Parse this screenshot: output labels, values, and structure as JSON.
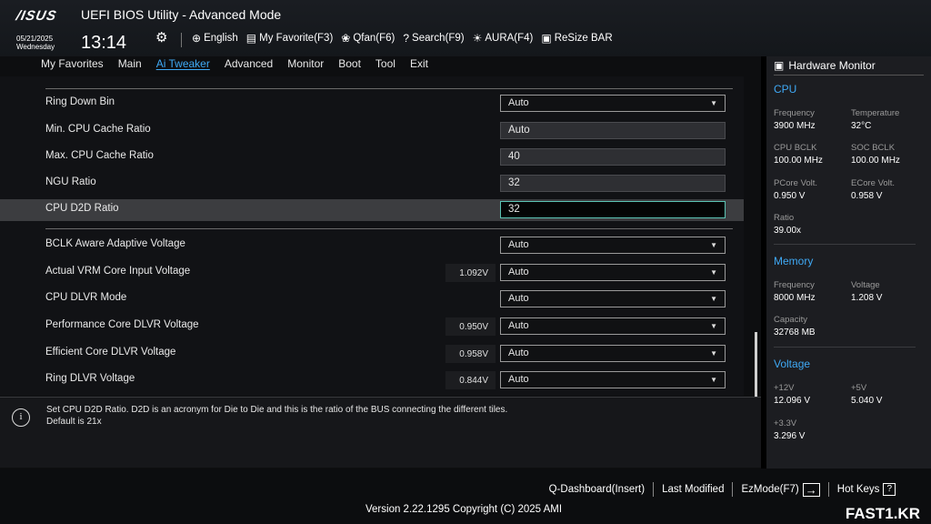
{
  "header": {
    "logo": "/ISUS",
    "title": "UEFI BIOS Utility - Advanced Mode",
    "date": "05/21/2025",
    "weekday": "Wednesday",
    "time": "13:14",
    "toolbar": [
      {
        "icon": "globe-icon",
        "glyph": "⊕",
        "label": "English"
      },
      {
        "icon": "favorite-icon",
        "glyph": "▤",
        "label": "My Favorite(F3)"
      },
      {
        "icon": "fan-icon",
        "glyph": "❀",
        "label": "Qfan(F6)"
      },
      {
        "icon": "search-icon",
        "glyph": "?",
        "label": "Search(F9)"
      },
      {
        "icon": "aura-icon",
        "glyph": "☀",
        "label": "AURA(F4)"
      },
      {
        "icon": "resize-bar-icon",
        "glyph": "▣",
        "label": "ReSize BAR"
      }
    ]
  },
  "tabs": [
    {
      "label": "My Favorites",
      "active": false
    },
    {
      "label": "Main",
      "active": false
    },
    {
      "label": "Ai Tweaker",
      "active": true
    },
    {
      "label": "Advanced",
      "active": false
    },
    {
      "label": "Monitor",
      "active": false
    },
    {
      "label": "Boot",
      "active": false
    },
    {
      "label": "Tool",
      "active": false
    },
    {
      "label": "Exit",
      "active": false
    }
  ],
  "settings": {
    "group1": [
      {
        "label": "Ring Down Bin",
        "type": "dropdown",
        "value": "Auto"
      },
      {
        "label": "Min. CPU Cache Ratio",
        "type": "field",
        "value": "Auto"
      },
      {
        "label": "Max. CPU Cache Ratio",
        "type": "field",
        "value": "40"
      },
      {
        "label": "NGU Ratio",
        "type": "field",
        "value": "32"
      },
      {
        "label": "CPU D2D Ratio",
        "type": "edit",
        "value": "32",
        "selected": true
      }
    ],
    "group2": [
      {
        "label": "BCLK Aware Adaptive Voltage",
        "type": "dropdown",
        "value": "Auto",
        "volt": ""
      },
      {
        "label": "Actual VRM Core Input Voltage",
        "type": "dropdown",
        "value": "Auto",
        "volt": "1.092V"
      },
      {
        "label": "CPU DLVR Mode",
        "type": "dropdown",
        "value": "Auto",
        "volt": ""
      },
      {
        "label": "Performance Core DLVR Voltage",
        "type": "dropdown",
        "value": "Auto",
        "volt": "0.950V"
      },
      {
        "label": "Efficient Core DLVR Voltage",
        "type": "dropdown",
        "value": "Auto",
        "volt": "0.958V"
      },
      {
        "label": "Ring DLVR Voltage",
        "type": "dropdown",
        "value": "Auto",
        "volt": "0.844V"
      }
    ]
  },
  "help": {
    "line1": "Set CPU D2D Ratio. D2D is an acronym for Die to Die and this is the ratio of the BUS connecting the different tiles.",
    "line2": "Default is 21x"
  },
  "hardware_monitor": {
    "title": "Hardware Monitor",
    "cpu": {
      "heading": "CPU",
      "frequency_label": "Frequency",
      "frequency": "3900 MHz",
      "temperature_label": "Temperature",
      "temperature": "32°C",
      "cpu_bclk_label": "CPU BCLK",
      "cpu_bclk": "100.00 MHz",
      "soc_bclk_label": "SOC BCLK",
      "soc_bclk": "100.00 MHz",
      "pcore_label": "PCore Volt.",
      "pcore": "0.950 V",
      "ecore_label": "ECore Volt.",
      "ecore": "0.958 V",
      "ratio_label": "Ratio",
      "ratio": "39.00x"
    },
    "memory": {
      "heading": "Memory",
      "frequency_label": "Frequency",
      "frequency": "8000 MHz",
      "voltage_label": "Voltage",
      "voltage": "1.208 V",
      "capacity_label": "Capacity",
      "capacity": "32768 MB"
    },
    "voltage": {
      "heading": "Voltage",
      "v12_label": "+12V",
      "v12": "12.096 V",
      "v5_label": "+5V",
      "v5": "5.040 V",
      "v33_label": "+3.3V",
      "v33": "3.296 V"
    }
  },
  "footer": {
    "qdashboard": "Q-Dashboard(Insert)",
    "last_modified": "Last Modified",
    "ezmode": "EzMode(F7)",
    "hotkeys": "Hot Keys",
    "version": "Version 2.22.1295 Copyright (C) 2025 AMI",
    "watermark": "FAST1.KR"
  }
}
